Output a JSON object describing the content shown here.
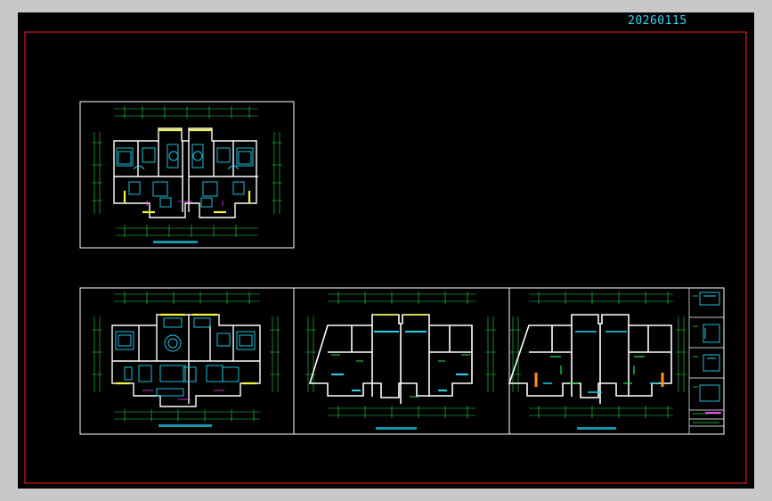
{
  "drawing_id": "20260115",
  "colors": {
    "background": "#000000",
    "outer_frame": "#ff2020",
    "sheet_border": "#ffffff",
    "wall": "#ffffff",
    "cyan": "#22d3f0",
    "green": "#22e045",
    "yellow": "#f5f53a",
    "magenta": "#ff40ff",
    "orange": "#ff9020",
    "id_text": "#3ad6f0"
  },
  "sheets": [
    {
      "id": "plan-furnished-top",
      "kind": "furnished"
    },
    {
      "id": "plan-furnished-bottom",
      "kind": "furnished"
    },
    {
      "id": "plan-walls-middle",
      "kind": "walls"
    },
    {
      "id": "plan-walls-right",
      "kind": "walls"
    }
  ]
}
